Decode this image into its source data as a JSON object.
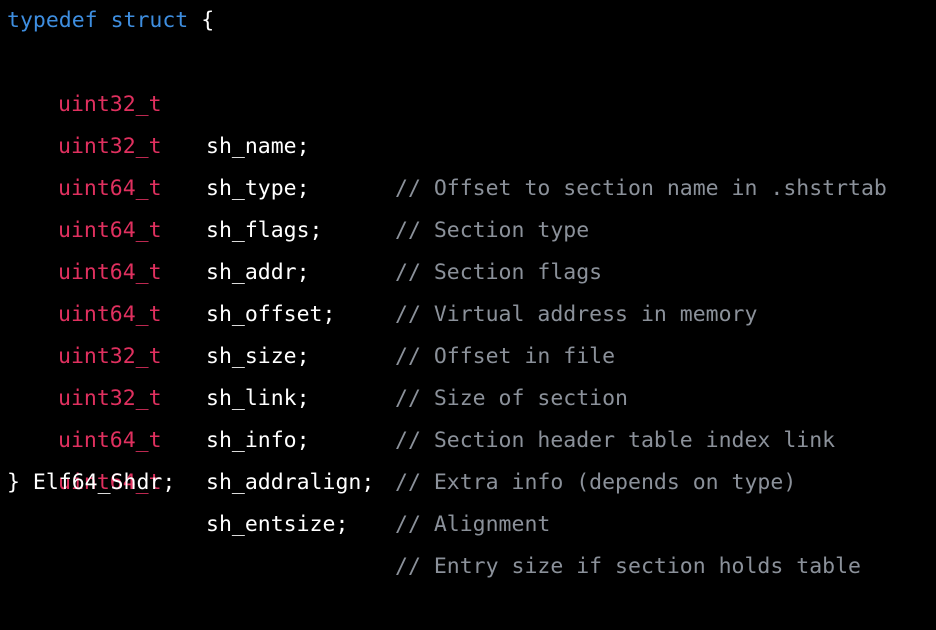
{
  "code": {
    "header": {
      "kw_typedef": "typedef",
      "kw_struct": "struct",
      "brace_open": "{"
    },
    "fields": [
      {
        "type": "uint32_t",
        "name": "sh_name;",
        "comment": "// Offset to section name in .shstrtab"
      },
      {
        "type": "uint32_t",
        "name": "sh_type;",
        "comment": "// Section type"
      },
      {
        "type": "uint64_t",
        "name": "sh_flags;",
        "comment": "// Section flags"
      },
      {
        "type": "uint64_t",
        "name": "sh_addr;",
        "comment": "// Virtual address in memory"
      },
      {
        "type": "uint64_t",
        "name": "sh_offset;",
        "comment": "// Offset in file"
      },
      {
        "type": "uint64_t",
        "name": "sh_size;",
        "comment": "// Size of section"
      },
      {
        "type": "uint32_t",
        "name": "sh_link;",
        "comment": "// Section header table index link"
      },
      {
        "type": "uint32_t",
        "name": "sh_info;",
        "comment": "// Extra info (depends on type)"
      },
      {
        "type": "uint64_t",
        "name": "sh_addralign;",
        "comment": "// Alignment"
      },
      {
        "type": "uint64_t",
        "name": "sh_entsize;",
        "comment": "// Entry size if section holds table"
      }
    ],
    "footer": {
      "closing": "} Elf64_Shdr;"
    }
  },
  "colors": {
    "background": "#000000",
    "keyword": "#3e8ee0",
    "type": "#e0305f",
    "comment": "#8b919a",
    "plain": "#ffffff"
  }
}
